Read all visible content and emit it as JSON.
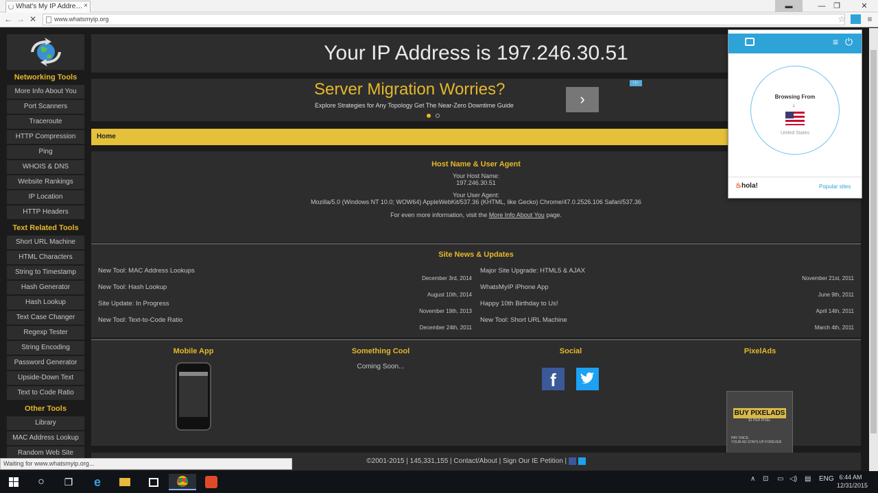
{
  "browser": {
    "tab_title": "What's My IP Addre…",
    "url": "www.whatsmyip.org",
    "status": "Waiting for www.whatsmyip.org..."
  },
  "ip_heading": "Your IP Address is 197.246.30.51",
  "ad": {
    "title": "Server Migration Worries?",
    "subtitle": "Explore Strategies for Any Topology Get The Near-Zero Downtime Guide",
    "button": "›",
    "badge": "i ▷"
  },
  "breadcrumb": "Home",
  "host": {
    "section_title": "Host Name & User Agent",
    "host_label": "Your Host Name:",
    "host_value": "197.246.30.51",
    "ua_label": "Your User Agent:",
    "ua_value": "Mozilla/5.0 (Windows NT 10.0; WOW64) AppleWebKit/537.36 (KHTML, like Gecko) Chrome/47.0.2526.106 Safari/537.36",
    "more_prefix": "For even more information, visit the",
    "more_link": "More Info About You",
    "more_suffix": "page."
  },
  "news": {
    "title": "Site News & Updates",
    "left": [
      {
        "t": "New Tool: MAC Address Lookups",
        "d": "December 3rd, 2014"
      },
      {
        "t": "New Tool: Hash Lookup",
        "d": "August 10th, 2014"
      },
      {
        "t": "Site Update: In Progress",
        "d": "November 19th, 2013"
      },
      {
        "t": "New Tool: Text-to-Code Ratio",
        "d": "December 24th, 2011"
      }
    ],
    "right": [
      {
        "t": "Major Site Upgrade: HTML5 & AJAX",
        "d": "November 21st, 2011"
      },
      {
        "t": "WhatsMyIP iPhone App",
        "d": "June 9th, 2011"
      },
      {
        "t": "Happy 10th Birthday to Us!",
        "d": "April 14th, 2011"
      },
      {
        "t": "New Tool: Short URL Machine",
        "d": "March 4th, 2011"
      }
    ]
  },
  "bottom": {
    "mobile": "Mobile App",
    "cool": "Something Cool",
    "cool_text": "Coming Soon...",
    "social": "Social",
    "pixelads": "PixelAds",
    "pixel_line1": "BUY PIXELADS",
    "pixel_line2": "$1 PER PIXEL",
    "pixel_line3": "PAY ONCE,",
    "pixel_line4": "YOUR AD STAYS UP FOREVER"
  },
  "footer": {
    "copy": "©2001-2015",
    "count": "145,331,155",
    "contact": "Contact/About",
    "petition": "Sign Our IE Petition"
  },
  "sidebar": {
    "networking": "Networking Tools",
    "net_items": [
      "More Info About You",
      "Port Scanners",
      "Traceroute",
      "HTTP Compression",
      "Ping",
      "WHOIS & DNS",
      "Website Rankings",
      "IP Location",
      "HTTP Headers"
    ],
    "text": "Text Related Tools",
    "text_items": [
      "Short URL Machine",
      "HTML Characters",
      "String to Timestamp",
      "Hash Generator",
      "Hash Lookup",
      "Text Case Changer",
      "Regexp Tester",
      "String Encoding",
      "Password Generator",
      "Upside-Down Text",
      "Text to Code Ratio"
    ],
    "other": "Other Tools",
    "other_items": [
      "Library",
      "MAC Address Lookup",
      "Random Web Site"
    ]
  },
  "hola": {
    "browsing_from": "Browsing From",
    "country": "United States",
    "brand": "hola!",
    "popular": "Popular sites"
  },
  "taskbar": {
    "lang": "ENG",
    "time": "6:44 AM",
    "date": "12/31/2015"
  },
  "colors": {
    "accent": "#e5b82b",
    "panel": "#2d2d2d",
    "hola_blue": "#2da3d8"
  }
}
